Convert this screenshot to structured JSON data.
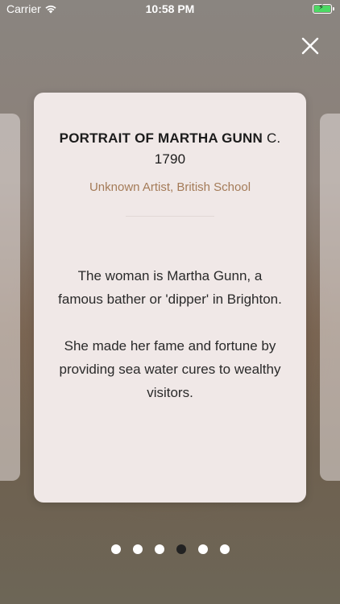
{
  "status": {
    "carrier": "Carrier",
    "time": "10:58 PM",
    "battery_color": "#4cd964"
  },
  "card": {
    "title": "PORTRAIT OF MARTHA GUNN",
    "title_suffix": "C. 1790",
    "artist": "Unknown Artist, British School",
    "description": [
      "The woman is Martha Gunn, a famous bather or 'dipper' in Brighton.",
      "She made her fame and fortune by providing sea water cures to wealthy visitors."
    ]
  },
  "pager": {
    "total": 6,
    "active_index": 3
  },
  "icons": {
    "close": "close-icon",
    "wifi": "wifi-icon",
    "battery": "battery-icon"
  }
}
